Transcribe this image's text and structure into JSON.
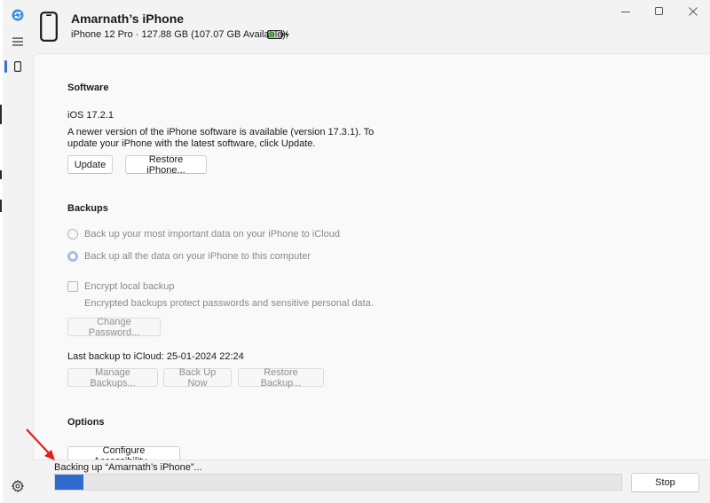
{
  "header": {
    "device_name": "Amarnath’s iPhone",
    "device_info": "iPhone 12 Pro · 127.88 GB (107.07 GB Available)",
    "battery_color": "#3ea83e"
  },
  "icons": {
    "app": "itunes-sync-icon",
    "menu": "hamburger-menu-icon",
    "device": "iphone-icon",
    "settings": "gear-icon",
    "battery": "battery-charging-icon"
  },
  "software": {
    "title": "Software",
    "version": "iOS 17.2.1",
    "update_msg_line1": "A newer version of the iPhone software is available (version 17.3.1). To",
    "update_msg_line2": "update your iPhone with the latest software, click Update.",
    "update_button": "Update",
    "restore_button": "Restore iPhone..."
  },
  "backups": {
    "title": "Backups",
    "option_icloud": "Back up your most important data on your iPhone to iCloud",
    "option_computer": "Back up all the data on your iPhone to this computer",
    "encrypt_label": "Encrypt local backup",
    "encrypt_desc": "Encrypted backups protect passwords and sensitive personal data.",
    "change_password_button": "Change Password...",
    "last_backup": "Last backup to iCloud: 25-01-2024 22:24",
    "manage_button": "Manage Backups...",
    "backup_now_button": "Back Up Now",
    "restore_backup_button": "Restore Backup..."
  },
  "options": {
    "title": "Options",
    "configure_button": "Configure Accessibility..."
  },
  "footer": {
    "status": "Backing up “Amarnath’s iPhone”...",
    "progress_percent": 5,
    "stop_button": "Stop"
  },
  "colors": {
    "accent": "#2f6ad0",
    "annotation_arrow": "#e02020"
  }
}
